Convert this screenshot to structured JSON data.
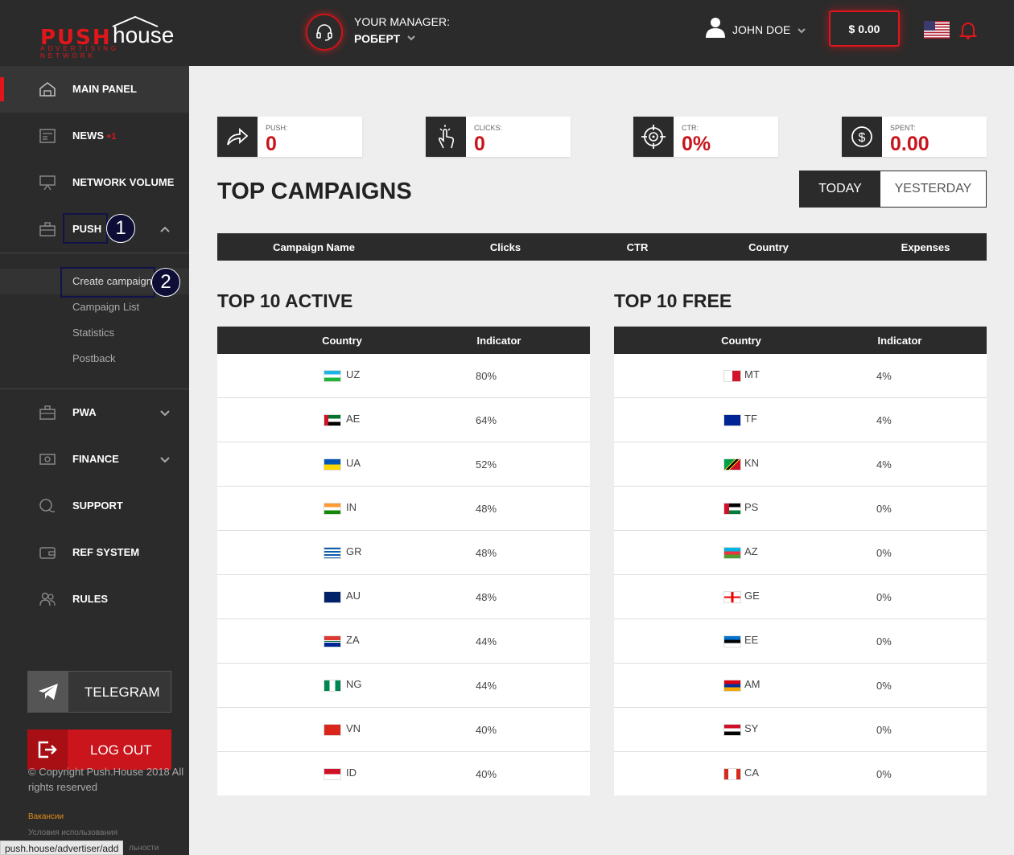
{
  "header": {
    "logo_push": "PUSH",
    "logo_house": "house",
    "logo_sub": "ADVERTISING NETWORK",
    "manager_label": "YOUR MANAGER:",
    "manager_name": "РОБЕРТ",
    "user_name": "JOHN DOE",
    "balance": "$ 0.00",
    "language_flag": "us-flag-icon",
    "notification_icon": "bell-icon"
  },
  "sidebar": {
    "items": [
      {
        "label": "MAIN PANEL",
        "icon": "home-icon"
      },
      {
        "label": "NEWS",
        "badge": "+1",
        "icon": "news-icon"
      },
      {
        "label": "NETWORK VOLUME",
        "icon": "presentation-icon"
      },
      {
        "label": "PUSH",
        "icon": "briefcase-icon"
      },
      {
        "label": "PWA",
        "icon": "briefcase-icon"
      },
      {
        "label": "FINANCE",
        "icon": "money-icon"
      },
      {
        "label": "SUPPORT",
        "icon": "chat-icon"
      },
      {
        "label": "REF SYSTEM",
        "icon": "wallet-icon"
      },
      {
        "label": "RULES",
        "icon": "users-icon"
      }
    ],
    "push_submenu": [
      "Create campaign",
      "Campaign List",
      "Statistics",
      "Postback"
    ],
    "telegram_label": "TELEGRAM",
    "logout_label": "LOG OUT",
    "copyright": "© Copyright Push.House 2018 All rights reserved",
    "vacancies": "Вакансии",
    "terms": "Условия использования",
    "privacy_partial": "льности"
  },
  "annotations": [
    "1",
    "2"
  ],
  "status_url": "push.house/advertiser/add",
  "stats": [
    {
      "label": "PUSH:",
      "value": "0",
      "icon": "share-arrow-icon"
    },
    {
      "label": "CLICKS:",
      "value": "0",
      "icon": "tap-hand-icon"
    },
    {
      "label": "CTR:",
      "value": "0%",
      "icon": "crosshair-icon"
    },
    {
      "label": "SPENT:",
      "value": "0.00",
      "icon": "dollar-coin-icon"
    }
  ],
  "top_campaigns": {
    "title": "TOP CAMPAIGNS",
    "tabs": [
      "TODAY",
      "YESTERDAY"
    ],
    "columns": [
      "Campaign Name",
      "Clicks",
      "CTR",
      "Country",
      "Expenses"
    ]
  },
  "top_active": {
    "title": "TOP 10 ACTIVE",
    "columns": [
      "Country",
      "Indicator"
    ],
    "rows": [
      {
        "code": "UZ",
        "value": "80%"
      },
      {
        "code": "AE",
        "value": "64%"
      },
      {
        "code": "UA",
        "value": "52%"
      },
      {
        "code": "IN",
        "value": "48%"
      },
      {
        "code": "GR",
        "value": "48%"
      },
      {
        "code": "AU",
        "value": "48%"
      },
      {
        "code": "ZA",
        "value": "44%"
      },
      {
        "code": "NG",
        "value": "44%"
      },
      {
        "code": "VN",
        "value": "40%"
      },
      {
        "code": "ID",
        "value": "40%"
      }
    ]
  },
  "top_free": {
    "title": "TOP 10 FREE",
    "columns": [
      "Country",
      "Indicator"
    ],
    "rows": [
      {
        "code": "MT",
        "value": "4%"
      },
      {
        "code": "TF",
        "value": "4%"
      },
      {
        "code": "KN",
        "value": "4%"
      },
      {
        "code": "PS",
        "value": "0%"
      },
      {
        "code": "AZ",
        "value": "0%"
      },
      {
        "code": "GE",
        "value": "0%"
      },
      {
        "code": "EE",
        "value": "0%"
      },
      {
        "code": "AM",
        "value": "0%"
      },
      {
        "code": "SY",
        "value": "0%"
      },
      {
        "code": "CA",
        "value": "0%"
      }
    ]
  }
}
